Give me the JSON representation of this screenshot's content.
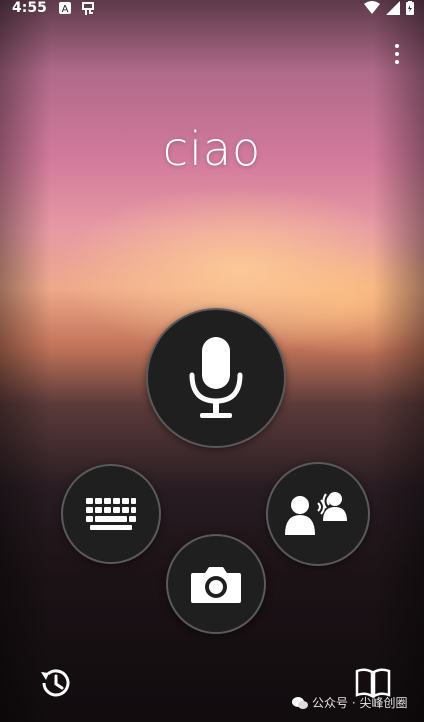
{
  "status_bar": {
    "time": "4:55",
    "notification_icons": [
      "a-badge-icon",
      "app-icon"
    ],
    "right_icons": [
      "wifi-icon",
      "signal-icon",
      "battery-icon"
    ]
  },
  "menu": {
    "icon": "more-vert-icon"
  },
  "phrase": {
    "text": "ciao"
  },
  "buttons": {
    "mic": {
      "icon": "microphone-icon"
    },
    "keyboard": {
      "icon": "keyboard-icon"
    },
    "conversation": {
      "icon": "conversation-icon"
    },
    "camera": {
      "icon": "camera-icon"
    }
  },
  "bottom": {
    "history": {
      "icon": "history-icon"
    },
    "phrasebook": {
      "icon": "phrasebook-icon"
    }
  },
  "watermark": {
    "text": "公众号 · 尖峰创圈"
  },
  "colors": {
    "button_bg": "#1f1f1f",
    "icon_fg": "#ffffff"
  }
}
